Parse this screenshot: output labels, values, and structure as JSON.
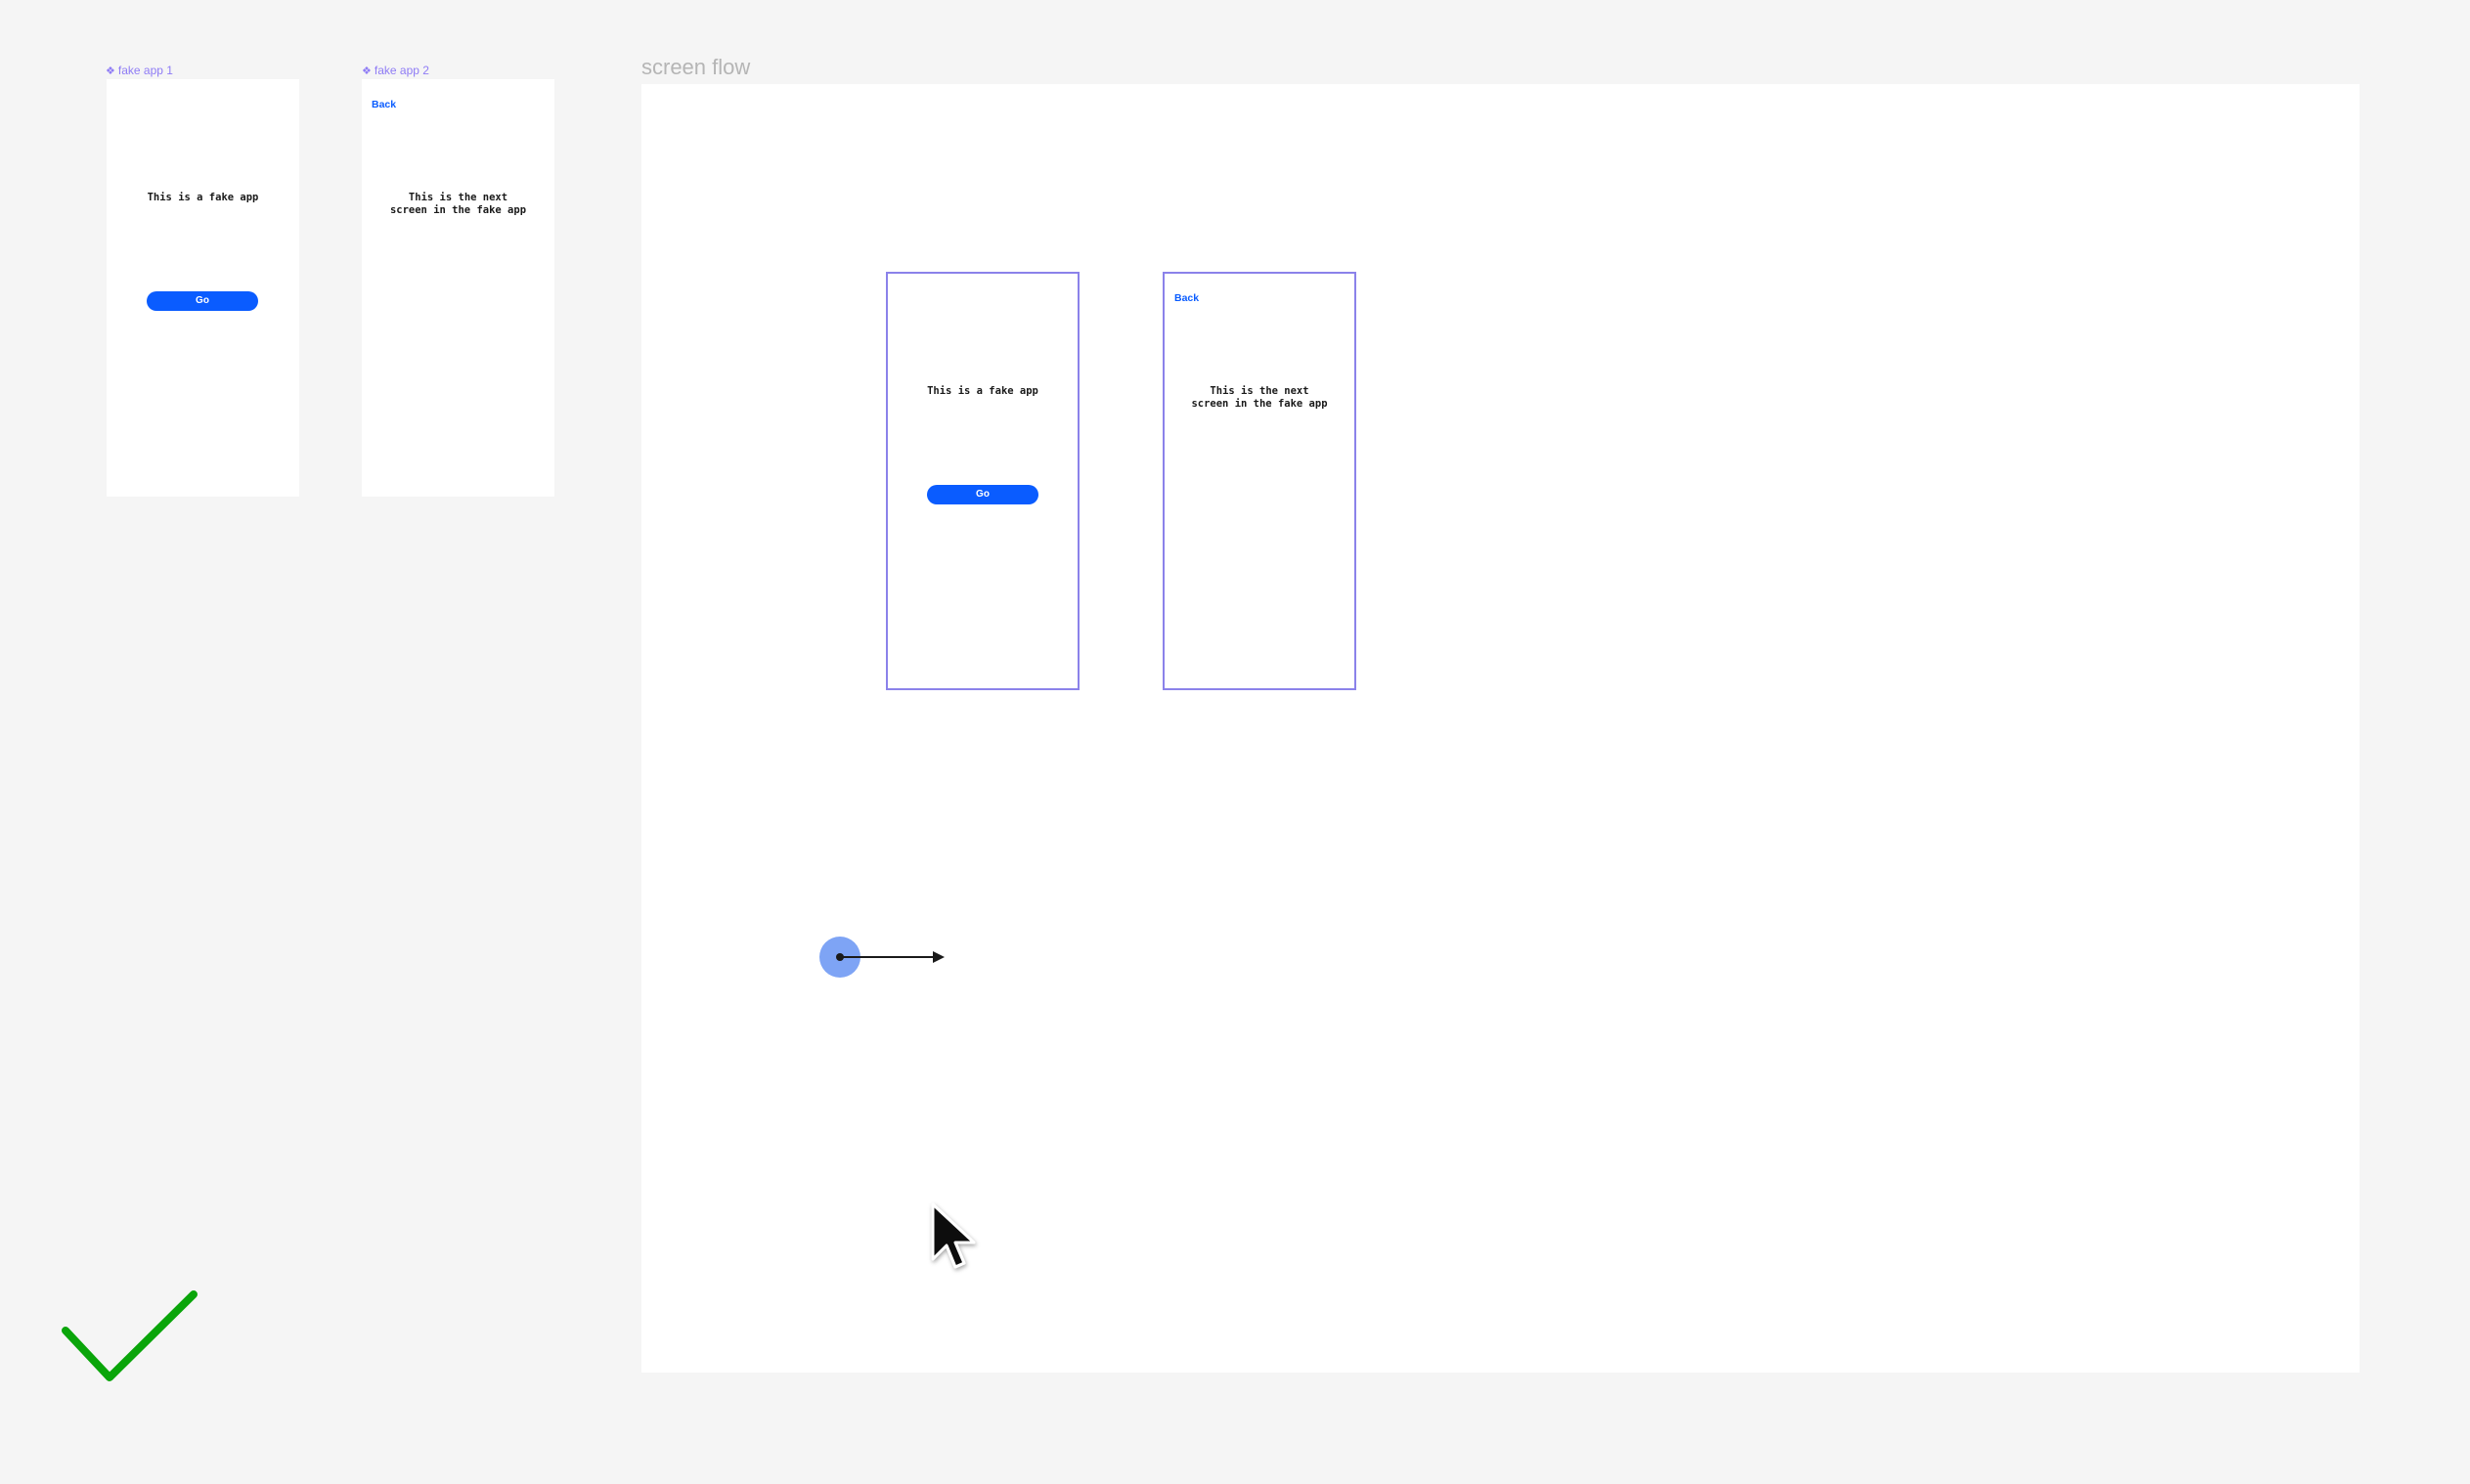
{
  "components": [
    {
      "label": "fake app 1",
      "icon": "component-icon"
    },
    {
      "label": "fake app 2",
      "icon": "component-icon"
    }
  ],
  "app": {
    "screen1_text": "This is a fake app",
    "go_label": "Go",
    "back_label": "Back",
    "screen2_text": "This is the next\nscreen in the fake app"
  },
  "section": {
    "title": "screen flow"
  },
  "colors": {
    "canvas_bg": "#f5f5f5",
    "accent_purple": "#8b82ea",
    "button_blue": "#0a5cff",
    "connector_handle": "#7ea4f5",
    "checkmark": "#0aa50a"
  },
  "icons": [
    "component-icon",
    "connector-handle-icon",
    "arrow-icon",
    "mouse-cursor-icon",
    "checkmark-icon"
  ]
}
